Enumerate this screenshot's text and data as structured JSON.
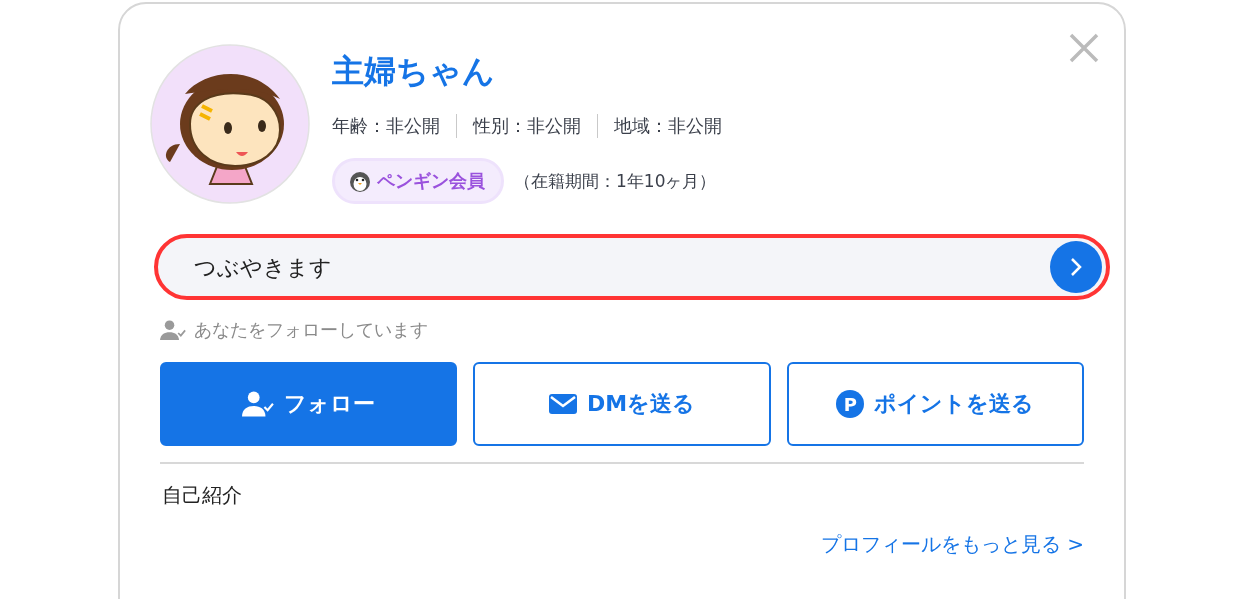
{
  "profile": {
    "name": "主婦ちゃん",
    "attributes": [
      "年齢：非公開",
      "性別：非公開",
      "地域：非公開"
    ],
    "membership_badge": "ペンギン会員",
    "tenure": "（在籍期間：1年10ヶ月）"
  },
  "tweet_field": {
    "placeholder": "つぶやきます",
    "highlighted": true
  },
  "follow_notice": "あなたをフォローしています",
  "actions": [
    {
      "kind": "follow",
      "label": "フォロー",
      "primary": true
    },
    {
      "kind": "dm",
      "label": "DMを送る",
      "primary": false
    },
    {
      "kind": "points",
      "label": "ポイントを送る",
      "primary": false,
      "icon_letter": "P"
    }
  ],
  "bio_heading": "自己紹介",
  "more_link": "プロフィールをもっと見る >"
}
